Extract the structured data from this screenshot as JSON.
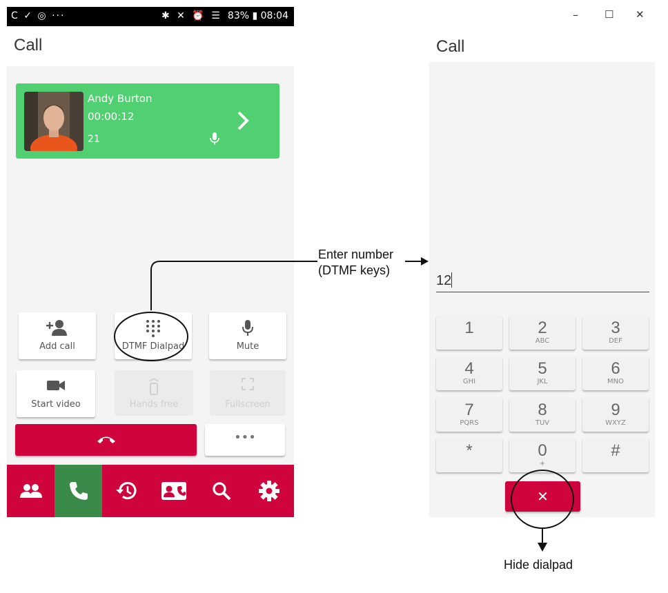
{
  "status_bar": {
    "left_icons": "C ✓ ◎ ···",
    "right_text": "83% ▮ 08:04"
  },
  "left_title": "Call",
  "right_title": "Call",
  "call_card": {
    "name": "Andy Burton",
    "duration": "00:00:12",
    "extension": "21"
  },
  "controls": {
    "add_call": "Add call",
    "dtmf_dialpad": "DTMF Dialpad",
    "mute": "Mute",
    "start_video": "Start video",
    "hands_free": "Hands free",
    "fullscreen": "Fullscreen",
    "more": "•••"
  },
  "navbar": {
    "items": [
      "contacts-icon",
      "phone-icon",
      "history-icon",
      "contact-card-icon",
      "search-icon",
      "settings-icon"
    ],
    "active": "phone-icon"
  },
  "window_controls": {
    "minimize": "–",
    "maximize": "☐",
    "close": "✕"
  },
  "dtmf": {
    "input_value": "12",
    "keys": [
      {
        "digit": "1",
        "letters": ""
      },
      {
        "digit": "2",
        "letters": "ABC"
      },
      {
        "digit": "3",
        "letters": "DEF"
      },
      {
        "digit": "4",
        "letters": "GHI"
      },
      {
        "digit": "5",
        "letters": "JKL"
      },
      {
        "digit": "6",
        "letters": "MNO"
      },
      {
        "digit": "7",
        "letters": "PQRS"
      },
      {
        "digit": "8",
        "letters": "TUV"
      },
      {
        "digit": "9",
        "letters": "WXYZ"
      },
      {
        "digit": "*",
        "letters": ""
      },
      {
        "digit": "0",
        "letters": "+"
      },
      {
        "digit": "#",
        "letters": ""
      }
    ],
    "hide_symbol": "✕"
  },
  "annotations": {
    "enter_line1": "Enter number",
    "enter_line2": "(DTMF keys)",
    "hide": "Hide dialpad"
  },
  "colors": {
    "brand_red": "#d0043c",
    "call_green": "#50d070",
    "nav_active": "#3a8a4a"
  }
}
